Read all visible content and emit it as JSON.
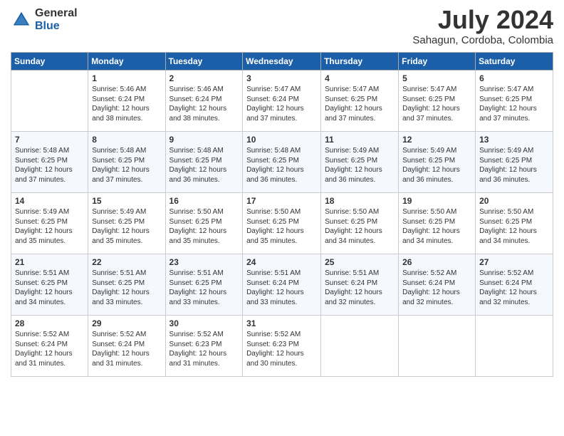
{
  "logo": {
    "general": "General",
    "blue": "Blue"
  },
  "title": "July 2024",
  "location": "Sahagun, Cordoba, Colombia",
  "headers": [
    "Sunday",
    "Monday",
    "Tuesday",
    "Wednesday",
    "Thursday",
    "Friday",
    "Saturday"
  ],
  "weeks": [
    [
      {
        "day": "",
        "info": ""
      },
      {
        "day": "1",
        "info": "Sunrise: 5:46 AM\nSunset: 6:24 PM\nDaylight: 12 hours\nand 38 minutes."
      },
      {
        "day": "2",
        "info": "Sunrise: 5:46 AM\nSunset: 6:24 PM\nDaylight: 12 hours\nand 38 minutes."
      },
      {
        "day": "3",
        "info": "Sunrise: 5:47 AM\nSunset: 6:24 PM\nDaylight: 12 hours\nand 37 minutes."
      },
      {
        "day": "4",
        "info": "Sunrise: 5:47 AM\nSunset: 6:25 PM\nDaylight: 12 hours\nand 37 minutes."
      },
      {
        "day": "5",
        "info": "Sunrise: 5:47 AM\nSunset: 6:25 PM\nDaylight: 12 hours\nand 37 minutes."
      },
      {
        "day": "6",
        "info": "Sunrise: 5:47 AM\nSunset: 6:25 PM\nDaylight: 12 hours\nand 37 minutes."
      }
    ],
    [
      {
        "day": "7",
        "info": "Sunrise: 5:48 AM\nSunset: 6:25 PM\nDaylight: 12 hours\nand 37 minutes."
      },
      {
        "day": "8",
        "info": "Sunrise: 5:48 AM\nSunset: 6:25 PM\nDaylight: 12 hours\nand 37 minutes."
      },
      {
        "day": "9",
        "info": "Sunrise: 5:48 AM\nSunset: 6:25 PM\nDaylight: 12 hours\nand 36 minutes."
      },
      {
        "day": "10",
        "info": "Sunrise: 5:48 AM\nSunset: 6:25 PM\nDaylight: 12 hours\nand 36 minutes."
      },
      {
        "day": "11",
        "info": "Sunrise: 5:49 AM\nSunset: 6:25 PM\nDaylight: 12 hours\nand 36 minutes."
      },
      {
        "day": "12",
        "info": "Sunrise: 5:49 AM\nSunset: 6:25 PM\nDaylight: 12 hours\nand 36 minutes."
      },
      {
        "day": "13",
        "info": "Sunrise: 5:49 AM\nSunset: 6:25 PM\nDaylight: 12 hours\nand 36 minutes."
      }
    ],
    [
      {
        "day": "14",
        "info": "Sunrise: 5:49 AM\nSunset: 6:25 PM\nDaylight: 12 hours\nand 35 minutes."
      },
      {
        "day": "15",
        "info": "Sunrise: 5:49 AM\nSunset: 6:25 PM\nDaylight: 12 hours\nand 35 minutes."
      },
      {
        "day": "16",
        "info": "Sunrise: 5:50 AM\nSunset: 6:25 PM\nDaylight: 12 hours\nand 35 minutes."
      },
      {
        "day": "17",
        "info": "Sunrise: 5:50 AM\nSunset: 6:25 PM\nDaylight: 12 hours\nand 35 minutes."
      },
      {
        "day": "18",
        "info": "Sunrise: 5:50 AM\nSunset: 6:25 PM\nDaylight: 12 hours\nand 34 minutes."
      },
      {
        "day": "19",
        "info": "Sunrise: 5:50 AM\nSunset: 6:25 PM\nDaylight: 12 hours\nand 34 minutes."
      },
      {
        "day": "20",
        "info": "Sunrise: 5:50 AM\nSunset: 6:25 PM\nDaylight: 12 hours\nand 34 minutes."
      }
    ],
    [
      {
        "day": "21",
        "info": "Sunrise: 5:51 AM\nSunset: 6:25 PM\nDaylight: 12 hours\nand 34 minutes."
      },
      {
        "day": "22",
        "info": "Sunrise: 5:51 AM\nSunset: 6:25 PM\nDaylight: 12 hours\nand 33 minutes."
      },
      {
        "day": "23",
        "info": "Sunrise: 5:51 AM\nSunset: 6:25 PM\nDaylight: 12 hours\nand 33 minutes."
      },
      {
        "day": "24",
        "info": "Sunrise: 5:51 AM\nSunset: 6:24 PM\nDaylight: 12 hours\nand 33 minutes."
      },
      {
        "day": "25",
        "info": "Sunrise: 5:51 AM\nSunset: 6:24 PM\nDaylight: 12 hours\nand 32 minutes."
      },
      {
        "day": "26",
        "info": "Sunrise: 5:52 AM\nSunset: 6:24 PM\nDaylight: 12 hours\nand 32 minutes."
      },
      {
        "day": "27",
        "info": "Sunrise: 5:52 AM\nSunset: 6:24 PM\nDaylight: 12 hours\nand 32 minutes."
      }
    ],
    [
      {
        "day": "28",
        "info": "Sunrise: 5:52 AM\nSunset: 6:24 PM\nDaylight: 12 hours\nand 31 minutes."
      },
      {
        "day": "29",
        "info": "Sunrise: 5:52 AM\nSunset: 6:24 PM\nDaylight: 12 hours\nand 31 minutes."
      },
      {
        "day": "30",
        "info": "Sunrise: 5:52 AM\nSunset: 6:23 PM\nDaylight: 12 hours\nand 31 minutes."
      },
      {
        "day": "31",
        "info": "Sunrise: 5:52 AM\nSunset: 6:23 PM\nDaylight: 12 hours\nand 30 minutes."
      },
      {
        "day": "",
        "info": ""
      },
      {
        "day": "",
        "info": ""
      },
      {
        "day": "",
        "info": ""
      }
    ]
  ]
}
